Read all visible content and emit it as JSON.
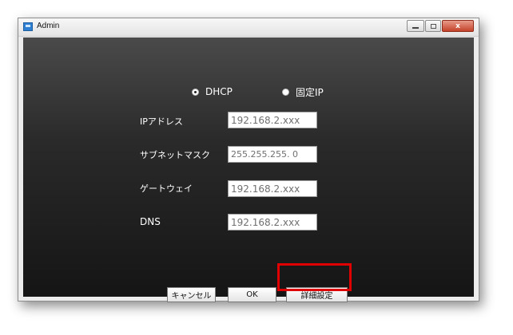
{
  "window": {
    "title": "Admin",
    "controls": {
      "minimize": "",
      "maximize": "",
      "close": "x"
    }
  },
  "mode": {
    "options": [
      {
        "label": "DHCP",
        "selected": true
      },
      {
        "label": "固定IP",
        "selected": false
      }
    ]
  },
  "fields": [
    {
      "label": "IPアドレス",
      "value": "192.168.2.xxx"
    },
    {
      "label": "サブネットマスク",
      "value": "255.255.255. 0"
    },
    {
      "label": "ゲートウェイ",
      "value": "192.168.2.xxx"
    },
    {
      "label": "DNS",
      "value": "192.168.2.xxx"
    }
  ],
  "buttons": {
    "cancel": "キャンセル",
    "ok": "OK",
    "advanced": "詳細設定"
  },
  "colors": {
    "highlight": "#e00000",
    "close_button": "#c44329"
  },
  "icons": {
    "app": "app-window-icon",
    "minimize": "minimize-icon",
    "maximize": "maximize-icon",
    "close": "close-icon"
  }
}
